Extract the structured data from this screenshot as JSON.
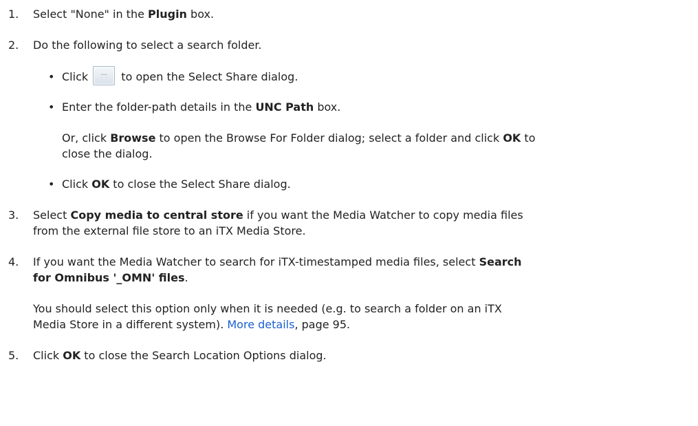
{
  "steps": [
    {
      "num": "1.",
      "pre": "Select \"None\" in the ",
      "bold": "Plugin",
      "post": " box."
    },
    {
      "num": "2.",
      "text": "Do the following to select a search folder."
    },
    {
      "bullet_a_pre": "Click ",
      "bullet_a_post": " to open the Select Share dialog.",
      "button_label": "...",
      "bullet_b_pre": "Enter the folder-path details in the ",
      "bullet_b_bold": "UNC Path",
      "bullet_b_post": " box.",
      "or_pre": "Or, click ",
      "or_bold1": "Browse",
      "or_mid": " to open the Browse For Folder dialog; select a folder and click ",
      "or_bold2": "OK",
      "or_post": " to",
      "or_line2": "close the dialog.",
      "bullet_c_pre": "Click ",
      "bullet_c_bold": "OK",
      "bullet_c_post": " to close the Select Share dialog."
    },
    {
      "num": "3.",
      "pre": "Select ",
      "bold": "Copy media to central store",
      "post": " if you want the Media Watcher to copy media files",
      "line2": "from the external file store to an iTX Media Store."
    },
    {
      "num": "4.",
      "pre": "If you want the Media Watcher to search for iTX-timestamped media files, select ",
      "bold": "Search",
      "line2_bold": "for Omnibus '_OMN' files",
      "line2_post": ".",
      "para_line1": "You should select this option only when it is needed (e.g. to search a folder on an iTX",
      "para_line2_pre": "Media Store in a different system). ",
      "link": "More details",
      "para_line2_post": ", page 95."
    },
    {
      "num": "5.",
      "pre": "Click ",
      "bold": "OK",
      "post": " to close the Search Location Options dialog."
    }
  ],
  "bullet_char": "•"
}
